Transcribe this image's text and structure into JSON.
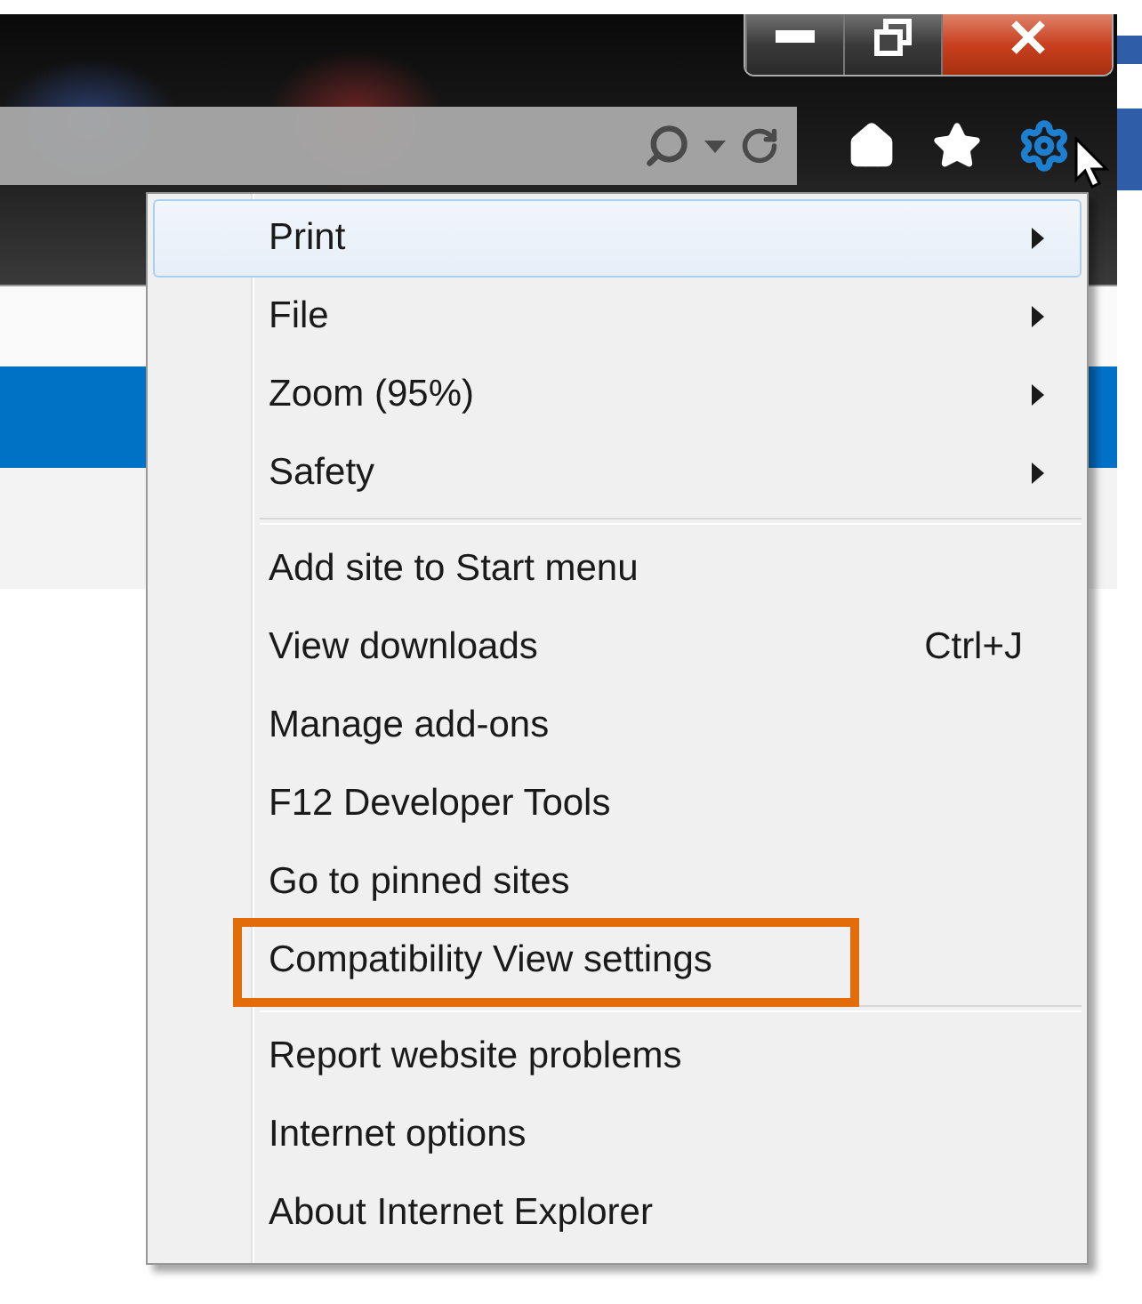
{
  "menu": {
    "groups": [
      [
        {
          "label": "Print",
          "submenu": true,
          "selected": true,
          "annotated": false
        },
        {
          "label": "File",
          "submenu": true,
          "selected": false,
          "annotated": false
        },
        {
          "label": "Zoom (95%)",
          "submenu": true,
          "selected": false,
          "annotated": false
        },
        {
          "label": "Safety",
          "submenu": true,
          "selected": false,
          "annotated": false
        }
      ],
      [
        {
          "label": "Add site to Start menu",
          "submenu": false,
          "selected": false,
          "annotated": false
        },
        {
          "label": "View downloads",
          "shortcut": "Ctrl+J",
          "submenu": false,
          "selected": false,
          "annotated": false
        },
        {
          "label": "Manage add-ons",
          "submenu": false,
          "selected": false,
          "annotated": false
        },
        {
          "label": "F12 Developer Tools",
          "submenu": false,
          "selected": false,
          "annotated": false
        },
        {
          "label": "Go to pinned sites",
          "submenu": false,
          "selected": false,
          "annotated": false
        },
        {
          "label": "Compatibility View settings",
          "submenu": false,
          "selected": false,
          "annotated": true
        }
      ],
      [
        {
          "label": "Report website problems",
          "submenu": false,
          "selected": false,
          "annotated": false
        },
        {
          "label": "Internet options",
          "submenu": false,
          "selected": false,
          "annotated": false
        },
        {
          "label": "About Internet Explorer",
          "submenu": false,
          "selected": false,
          "annotated": false
        }
      ]
    ]
  }
}
